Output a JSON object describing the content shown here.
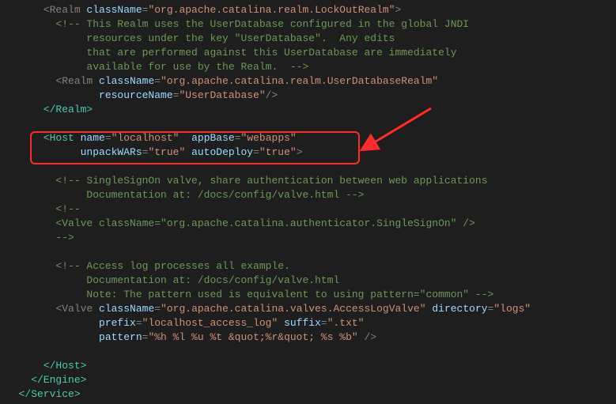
{
  "line1_open": "      <Realm ",
  "line1_attr_n": "className",
  "line1_attr_v": "\"org.apache.catalina.realm.LockOutRealm\"",
  "line1_close": ">",
  "comment1_l1": "        <!-- This Realm uses the UserDatabase configured in the global JNDI",
  "comment1_l2": "             resources under the key \"UserDatabase\".  Any edits",
  "comment1_l3": "             that are performed against this UserDatabase are immediately",
  "comment1_l4": "             available for use by the Realm.  -->",
  "line2_open": "        <Realm ",
  "line2_a1n": "className",
  "line2_a1v": "\"org.apache.catalina.realm.UserDatabaseRealm\"",
  "line2b_a2n": "               resourceName",
  "line2b_a2v": "\"UserDatabase\"",
  "line2b_close": "/>",
  "line3_close": "      </Realm>",
  "host_open": "      <Host ",
  "host_a1n": "name",
  "host_a1v": "\"localhost\"",
  "host_sp": "  ",
  "host_a2n": "appBase",
  "host_a2v": "\"webapps\"",
  "hostb_a3n": "            unpackWARs",
  "hostb_a3v": "\"true\"",
  "hostb_sp": " ",
  "hostb_a4n": "autoDeploy",
  "hostb_a4v": "\"true\"",
  "hostb_close": ">",
  "comment2_l1": "        <!-- SingleSignOn valve, share authentication between web applications",
  "comment2_l2": "             Documentation at: /docs/config/valve.html -->",
  "comment2_l3": "        <!--",
  "comment2_l4": "        <Valve className=\"org.apache.catalina.authenticator.SingleSignOn\" />",
  "comment2_l5": "        -->",
  "comment3_l1": "        <!-- Access log processes all example.",
  "comment3_l2": "             Documentation at: /docs/config/valve.html",
  "comment3_l3": "             Note: The pattern used is equivalent to using pattern=\"common\" -->",
  "valve_open": "        <Valve ",
  "valve_a1n": "className",
  "valve_a1v": "\"org.apache.catalina.valves.AccessLogValve\"",
  "valve_sp": " ",
  "valve_a2n": "directory",
  "valve_a2v": "\"logs\"",
  "valveb_a3n": "               prefix",
  "valveb_a3v": "\"localhost_access_log\"",
  "valveb_sp": " ",
  "valveb_a4n": "suffix",
  "valveb_a4v": "\".txt\"",
  "valvec_a5n": "               pattern",
  "valvec_a5v": "\"%h %l %u %t &quot;%r&quot; %s %b\"",
  "valvec_close": " />",
  "host_close": "      </Host>",
  "engine_close": "    </Engine>",
  "service_close": "  </Service>"
}
